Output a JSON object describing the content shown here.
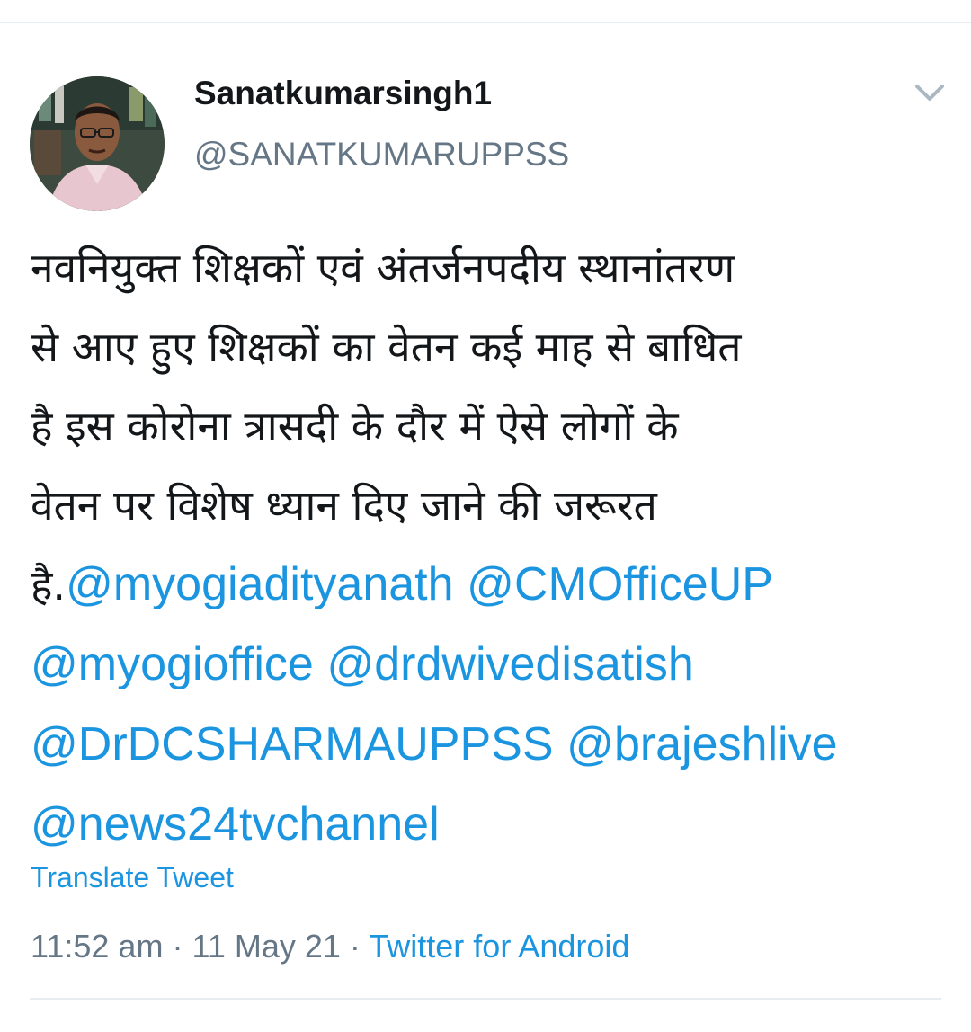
{
  "tweet": {
    "display_name": "Sanatkumarsingh1",
    "handle": "@SANATKUMARUPPSS",
    "text_line1": "नवनियुक्त शिक्षकों एवं अंतर्जनपदीय स्थानांतरण",
    "text_line2": "से आए हुए शिक्षकों का वेतन कई माह से बाधित",
    "text_line3": "है इस कोरोना त्रासदी के दौर में ऐसे लोगों के",
    "text_line4": "वेतन पर विशेष ध्यान दिए जाने की जरूरत",
    "text_line5_prefix": "है.",
    "mentions": [
      "@myogiadityanath",
      "@CMOfficeUP",
      "@myogioffice",
      "@drdwivedisatish",
      "@DrDCSHARMAUPPSS",
      "@brajeshlive",
      "@news24tvchannel"
    ],
    "translate_label": "Translate Tweet",
    "time": "11:52 am",
    "date": "11 May 21",
    "source": "Twitter for Android",
    "separator": "·"
  },
  "colors": {
    "link": "#1b95e0",
    "secondary_text": "#657786",
    "primary_text": "#14171a",
    "divider": "#e6ecf0"
  },
  "icons": {
    "menu": "chevron-down-icon",
    "avatar": "profile-photo"
  }
}
